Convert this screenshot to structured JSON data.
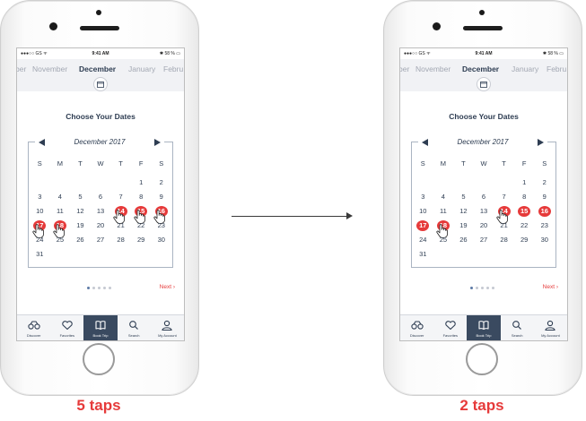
{
  "colors": {
    "accent": "#e63a3a",
    "navy": "#2e3d52",
    "active_tab": "#3a4a60"
  },
  "phones": [
    {
      "status": {
        "carrier": "●●●○○ GS ᯤ",
        "time": "9:41 AM",
        "battery": "✱ 58 % ▭"
      },
      "months": [
        "ber",
        "November",
        "December",
        "January",
        "Febru"
      ],
      "choose_title": "Choose Your Dates",
      "calendar": {
        "month_label": "December 2017",
        "weekdays": [
          "S",
          "M",
          "T",
          "W",
          "T",
          "F",
          "S"
        ],
        "weeks": [
          [
            "",
            "",
            "",
            "",
            "",
            "1",
            "2"
          ],
          [
            "3",
            "4",
            "5",
            "6",
            "7",
            "8",
            "9"
          ],
          [
            "10",
            "11",
            "12",
            "13",
            "14",
            "15",
            "16"
          ],
          [
            "17",
            "18",
            "19",
            "20",
            "21",
            "22",
            "23"
          ],
          [
            "24",
            "25",
            "26",
            "27",
            "28",
            "29",
            "30"
          ],
          [
            "31",
            "",
            "",
            "",
            "",
            "",
            ""
          ]
        ],
        "selected": [
          "14",
          "15",
          "16",
          "17",
          "18"
        ],
        "tapped": [
          "14",
          "15",
          "16",
          "17",
          "18"
        ]
      },
      "next_label": "Next ›",
      "tabs": [
        {
          "label": "Discover",
          "icon": "binoculars-icon"
        },
        {
          "label": "Favorites",
          "icon": "heart-icon"
        },
        {
          "label": "Book Trip",
          "icon": "book-icon"
        },
        {
          "label": "Search",
          "icon": "search-icon"
        },
        {
          "label": "My Account",
          "icon": "user-icon"
        }
      ],
      "caption": "5 taps"
    },
    {
      "status": {
        "carrier": "●●●○○ GS ᯤ",
        "time": "9:41 AM",
        "battery": "✱ 58 % ▭"
      },
      "months": [
        "ber",
        "November",
        "December",
        "January",
        "Febru"
      ],
      "choose_title": "Choose Your Dates",
      "calendar": {
        "month_label": "December 2017",
        "weekdays": [
          "S",
          "M",
          "T",
          "W",
          "T",
          "F",
          "S"
        ],
        "weeks": [
          [
            "",
            "",
            "",
            "",
            "",
            "1",
            "2"
          ],
          [
            "3",
            "4",
            "5",
            "6",
            "7",
            "8",
            "9"
          ],
          [
            "10",
            "11",
            "12",
            "13",
            "14",
            "15",
            "16"
          ],
          [
            "17",
            "18",
            "19",
            "20",
            "21",
            "22",
            "23"
          ],
          [
            "24",
            "25",
            "26",
            "27",
            "28",
            "29",
            "30"
          ],
          [
            "31",
            "",
            "",
            "",
            "",
            "",
            ""
          ]
        ],
        "selected": [
          "14",
          "15",
          "16",
          "17",
          "18"
        ],
        "tapped": [
          "14",
          "18"
        ]
      },
      "next_label": "Next ›",
      "tabs": [
        {
          "label": "Discover",
          "icon": "binoculars-icon"
        },
        {
          "label": "Favorites",
          "icon": "heart-icon"
        },
        {
          "label": "Book Trip",
          "icon": "book-icon"
        },
        {
          "label": "Search",
          "icon": "search-icon"
        },
        {
          "label": "My Account",
          "icon": "user-icon"
        }
      ],
      "caption": "2 taps"
    }
  ]
}
